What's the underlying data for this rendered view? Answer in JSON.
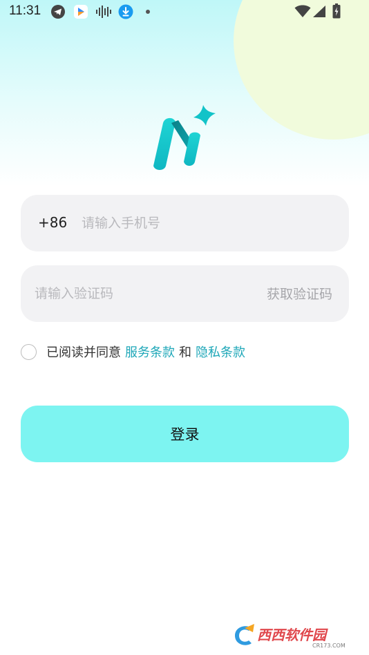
{
  "status_bar": {
    "time": "11:31",
    "icons": [
      "telegram-icon",
      "app-icon",
      "audio-wave-icon",
      "download-icon",
      "dot-icon",
      "wifi-icon",
      "signal-icon",
      "battery-icon"
    ]
  },
  "login": {
    "country_code": "+86",
    "phone_placeholder": "请输入手机号",
    "code_placeholder": "请输入验证码",
    "get_code_label": "获取验证码",
    "agreement": {
      "prefix": "已阅读并同意",
      "terms_label": "服务条款",
      "and": "和",
      "privacy_label": "隐私条款",
      "checked": false
    },
    "submit_label": "登录"
  },
  "colors": {
    "accent": "#1ea7b8",
    "button_bg": "#7df4f1",
    "field_bg": "#f2f2f4",
    "logo_teal": "#14c9cc"
  },
  "watermark": {
    "text": "西西软件园",
    "url_text": "CR173.COM"
  }
}
